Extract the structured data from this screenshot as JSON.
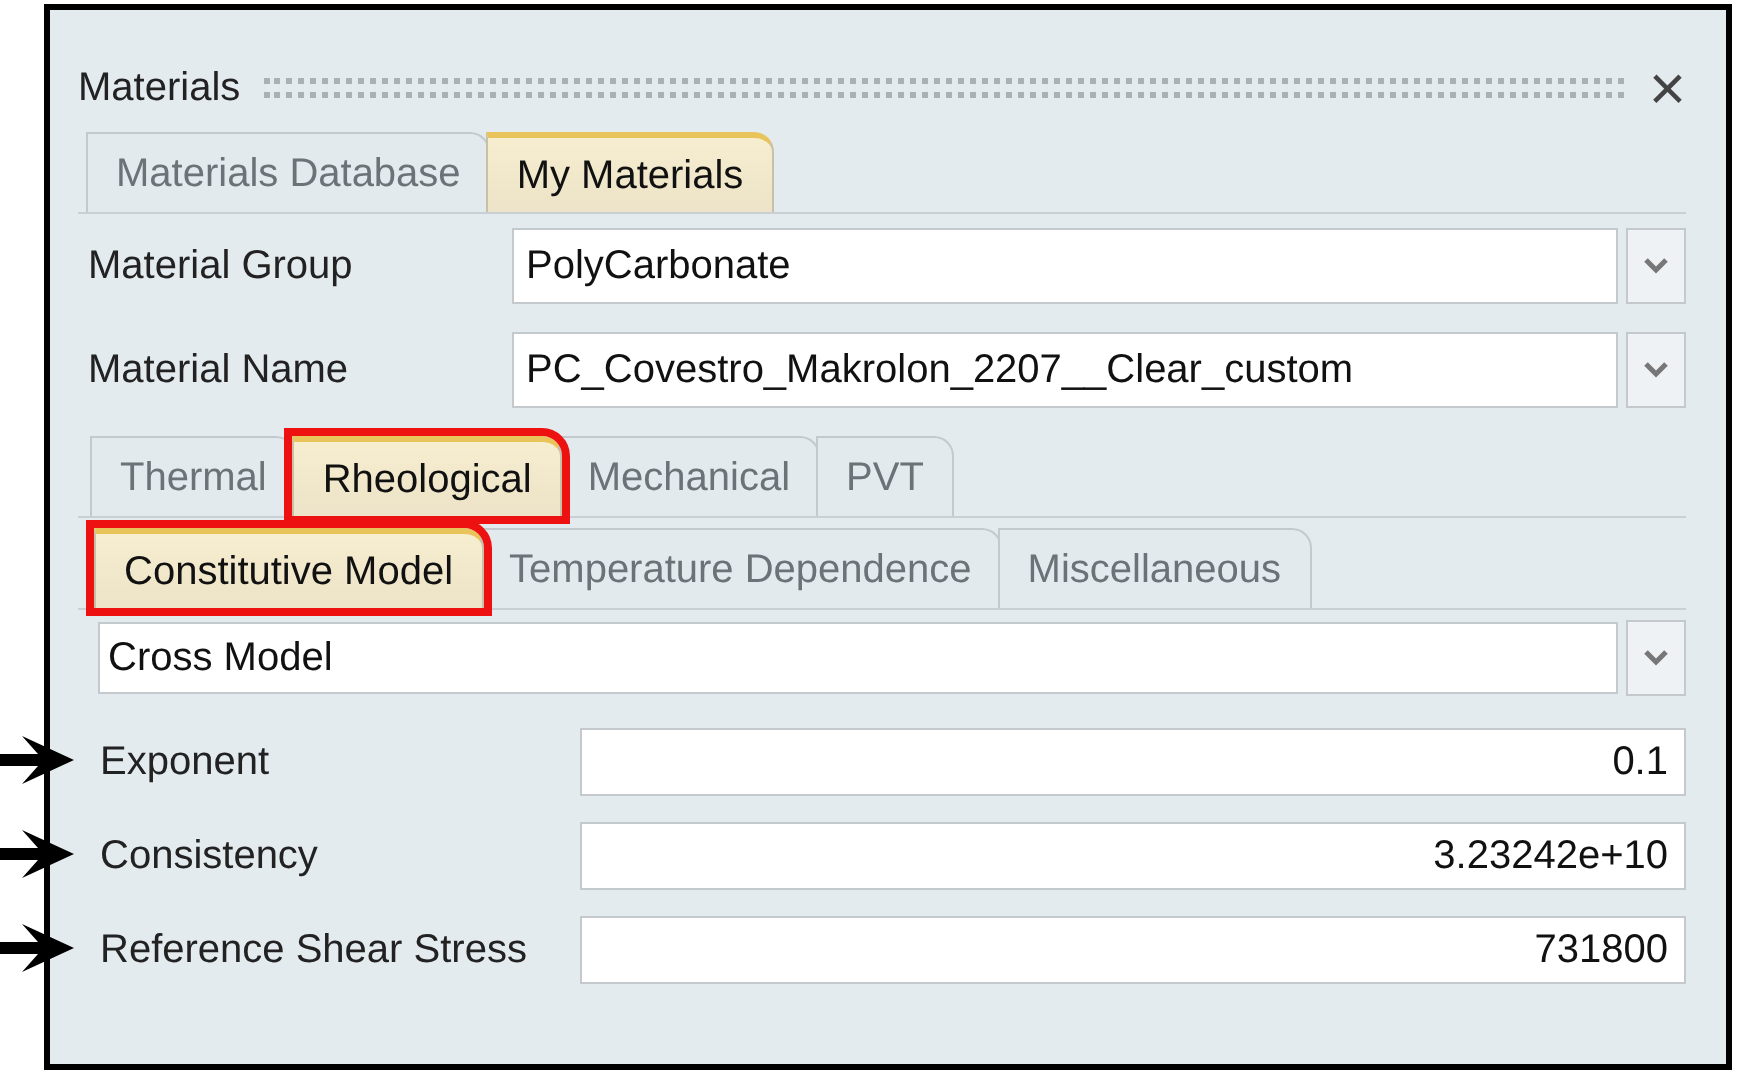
{
  "panel": {
    "title": "Materials",
    "close": "×"
  },
  "source_tabs": [
    {
      "label": "Materials Database",
      "selected": false
    },
    {
      "label": "My Materials",
      "selected": true
    }
  ],
  "selectors": [
    {
      "label": "Material Group",
      "value": "PolyCarbonate"
    },
    {
      "label": "Material Name",
      "value": "PC_Covestro_Makrolon_2207__Clear_custom"
    }
  ],
  "property_tabs": [
    {
      "label": "Thermal",
      "selected": false,
      "highlighted": false
    },
    {
      "label": "Rheological",
      "selected": true,
      "highlighted": true
    },
    {
      "label": "Mechanical",
      "selected": false,
      "highlighted": false
    },
    {
      "label": "PVT",
      "selected": false,
      "highlighted": false
    }
  ],
  "rheology_tabs": [
    {
      "label": "Constitutive Model",
      "selected": true,
      "highlighted": true
    },
    {
      "label": "Temperature Dependence",
      "selected": false,
      "highlighted": false
    },
    {
      "label": "Miscellaneous",
      "selected": false,
      "highlighted": false
    }
  ],
  "model": {
    "value": "Cross Model"
  },
  "parameters": [
    {
      "label": "Exponent",
      "value": "0.1",
      "pointed": true
    },
    {
      "label": "Consistency",
      "value": "3.23242e+10",
      "pointed": true
    },
    {
      "label": "Reference Shear Stress",
      "value": "731800",
      "pointed": true
    }
  ]
}
